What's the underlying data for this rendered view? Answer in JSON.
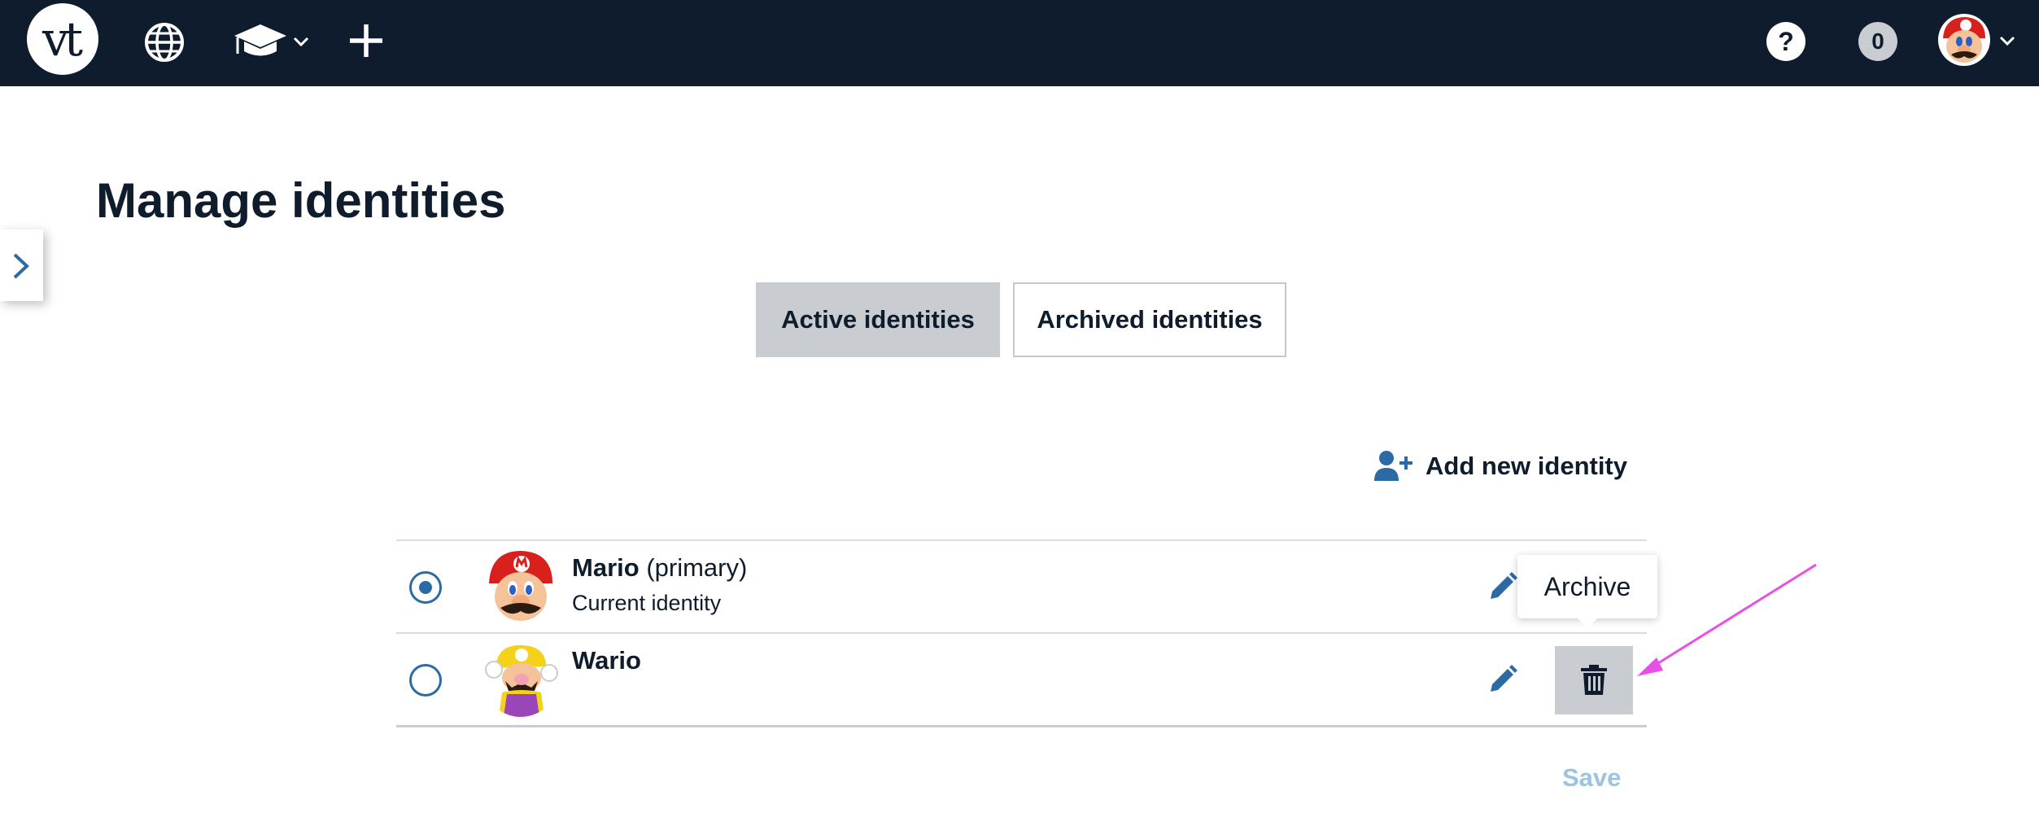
{
  "topbar": {
    "logo_text": "vt",
    "help_label": "?",
    "notification_count": "0",
    "icons": [
      "globe-icon",
      "graduation-cap-icon",
      "chevron-down-icon",
      "plus-icon",
      "help-icon",
      "user-avatar",
      "chevron-down-icon"
    ]
  },
  "page": {
    "title": "Manage identities"
  },
  "tabs": [
    {
      "label": "Active identities",
      "active": true
    },
    {
      "label": "Archived identities",
      "active": false
    }
  ],
  "add_identity": {
    "label": "Add new identity",
    "icon": "user-plus-icon"
  },
  "identities": [
    {
      "name": "Mario",
      "tag": "(primary)",
      "subtitle": "Current identity",
      "selected": true
    },
    {
      "name": "Wario",
      "tag": "",
      "subtitle": "",
      "selected": false
    }
  ],
  "tooltip": {
    "text": "Archive"
  },
  "actions": {
    "save_label": "Save"
  },
  "colors": {
    "topbar": "#0f1c2d",
    "accent": "#2c6aa6",
    "tab_active": "#c9ccd1",
    "save_disabled": "#9cc3e0",
    "annotation_arrow": "#e94fe6"
  }
}
